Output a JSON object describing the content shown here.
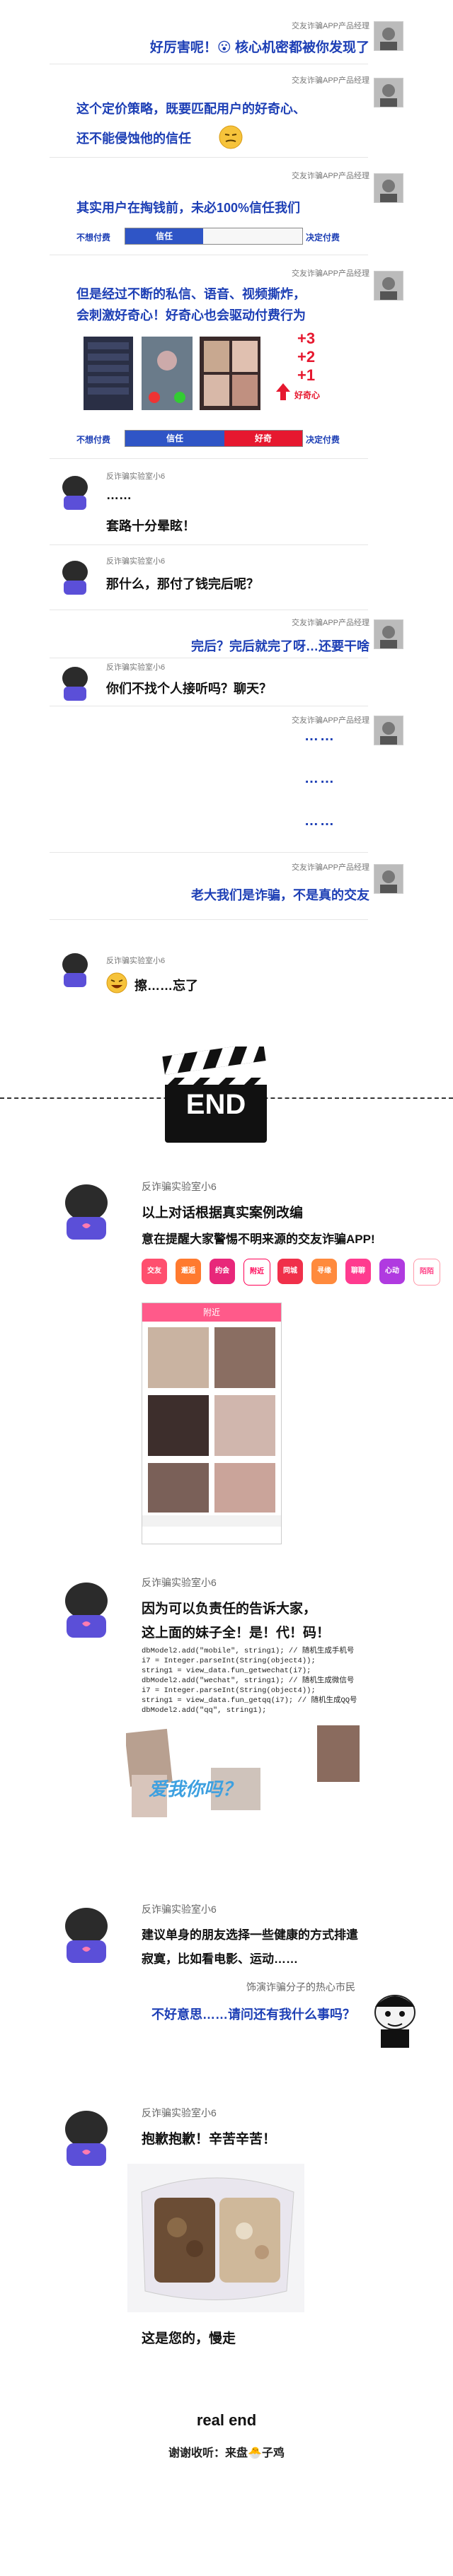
{
  "messages": {
    "m1": {
      "sender": "交友诈骗APP产品经理",
      "text": "好厉害呢！😮 核心机密都被你发现了"
    },
    "m2": {
      "sender": "交友诈骗APP产品经理",
      "line1": "这个定价策略，既要匹配用户的好奇心、",
      "line2": "还不能侵蚀他的信任"
    },
    "m3": {
      "sender": "交友诈骗APP产品经理",
      "text": "其实用户在掏钱前，未必100%信任我们"
    },
    "bar1": {
      "left": "不想付费",
      "fill": "信任",
      "right": "决定付费"
    },
    "m4": {
      "sender": "交友诈骗APP产品经理",
      "line1": "但是经过不断的私信、语音、视频撕炸，",
      "line2": "会刺激好奇心！好奇心也会驱动付费行为"
    },
    "curious_label": "好奇心",
    "plus1": "+3",
    "plus2": "+2",
    "plus3": "+1",
    "bar2": {
      "left": "不想付费",
      "fill1": "信任",
      "fill2": "好奇",
      "right": "决定付费"
    },
    "u1": {
      "sender": "反诈骗实验室小6",
      "text": "……"
    },
    "u2": {
      "text": "套路十分晕眩！"
    },
    "u3": {
      "sender": "反诈骗实验室小6",
      "text": "那什么，那付了钱完后呢？"
    },
    "m5": {
      "sender": "交友诈骗APP产品经理",
      "text": "完后？完后就完了呀…还要干啥"
    },
    "u4": {
      "sender": "反诈骗实验室小6",
      "text": "你们不找个人接听吗？聊天？"
    },
    "m6": {
      "sender": "交友诈骗APP产品经理",
      "dots1": "……",
      "dots2": "……",
      "dots3": "……"
    },
    "m7": {
      "sender": "交友诈骗APP产品经理",
      "text": "老大我们是诈骗，不是真的交友"
    },
    "u5": {
      "sender": "反诈骗实验室小6",
      "text": "擦……忘了"
    },
    "end_label": "END",
    "s1": {
      "sender": "反诈骗实验室小6",
      "line1": "以上对话根据真实案例改编",
      "line2": "意在提醒大家警惕不明来源的交友诈骗APP!"
    },
    "app_names": [
      "交友",
      "邂逅",
      "约会",
      "附近",
      "同城",
      "寻缘",
      "聊聊",
      "心动",
      "陌陌"
    ],
    "phone_title": "附近",
    "s2": {
      "sender": "反诈骗实验室小6",
      "line1": "因为可以负责任的告诉大家，",
      "line2": "这上面的妹子全！是！代！码！"
    },
    "code": [
      "dbModel2.add(\"mobile\", string1); // 随机生成手机号",
      "i7 = Integer.parseInt(String(object4));",
      "string1 = view_data.fun_getwechat(i7);",
      "dbModel2.add(\"wechat\", string1); // 随机生成微信号",
      "i7 = Integer.parseInt(String(object4));",
      "string1 = view_data.fun_getqq(i7); // 随机生成QQ号",
      "dbModel2.add(\"qq\", string1);"
    ],
    "stamp_text": "爱我你吗？",
    "s3": {
      "sender": "反诈骗实验室小6",
      "line1": "建议单身的朋友选择一些健康的方式排遣",
      "line2": "寂寞，比如看电影、运动……"
    },
    "s4": {
      "sender": "饰演诈骗分子的热心市民",
      "text": "不好意思……请问还有我什么事吗？"
    },
    "s5": {
      "sender": "反诈骗实验室小6",
      "text": "抱歉抱歉！辛苦辛苦！"
    },
    "s6": {
      "text": "这是您的，慢走"
    },
    "footer": {
      "title": "real end",
      "credit": "谢谢收听：来盘🐣子鸡"
    }
  },
  "colors": {
    "blue": "#1d3fb5",
    "trust": "#2f55c6",
    "curious": "#e6182f",
    "pink_icon": "#ff4f8a"
  }
}
